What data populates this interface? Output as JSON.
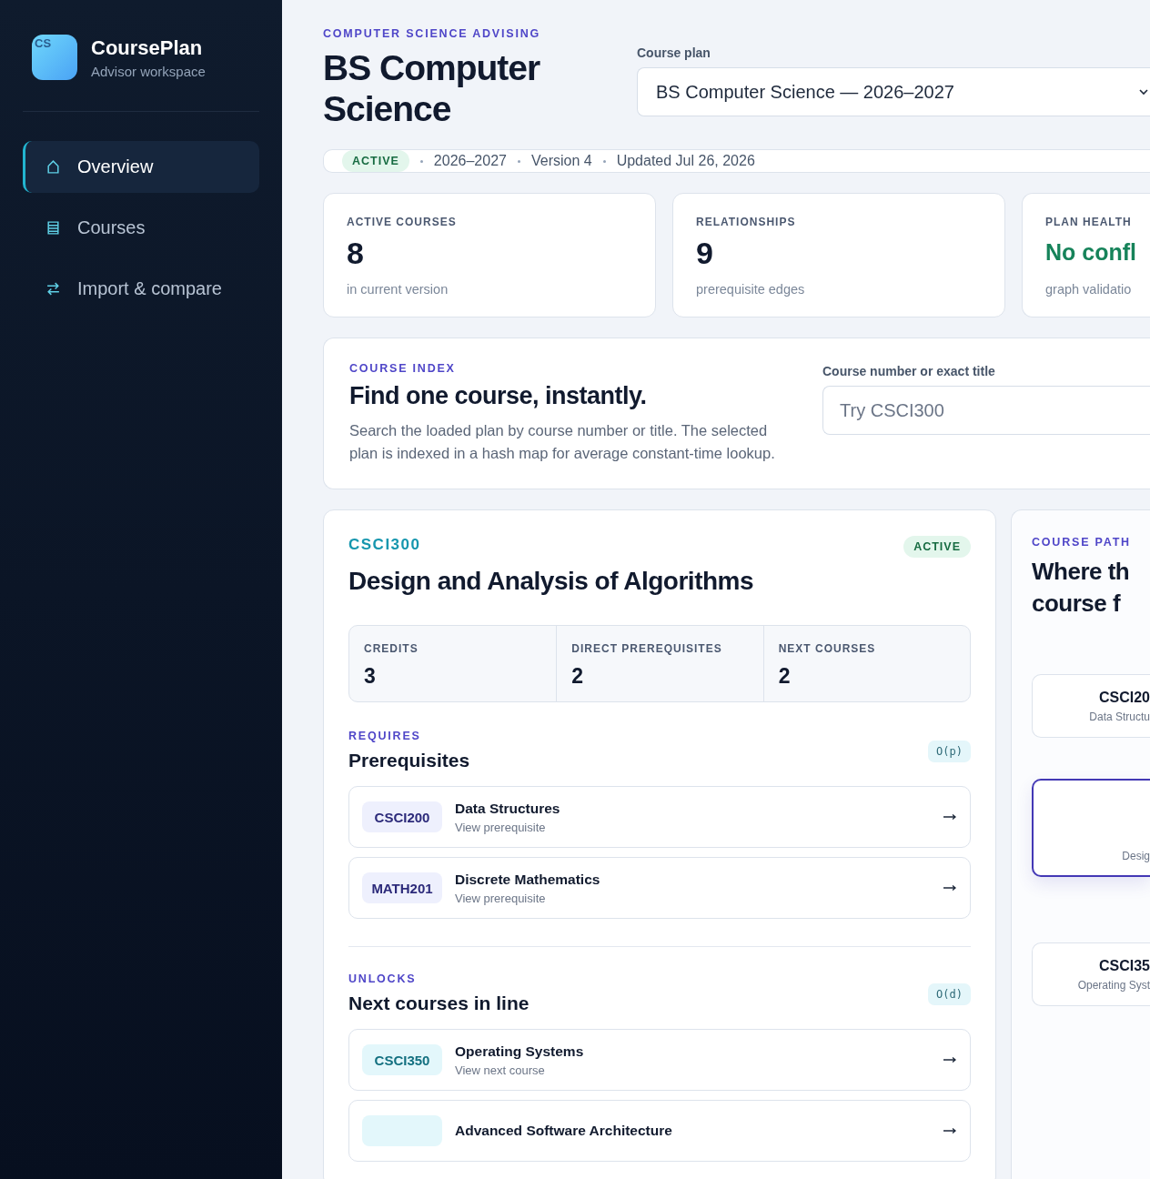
{
  "sidebar": {
    "logo_text": "CS",
    "app_name": "CoursePlan",
    "subtitle": "Advisor workspace",
    "items": [
      {
        "label": "Overview",
        "kind": "home",
        "selected": true
      },
      {
        "label": "Courses",
        "kind": "list",
        "selected": false
      },
      {
        "label": "Import & compare",
        "kind": "swap",
        "selected": false
      }
    ]
  },
  "header": {
    "eyebrow": "COMPUTER SCIENCE ADVISING",
    "title": "BS Computer Science",
    "plan_label": "Course plan",
    "plan_value": "BS Computer Science — 2026–2027"
  },
  "meta": {
    "status": "ACTIVE",
    "items": [
      "2026–2027",
      "Version 4",
      "Updated Jul 26, 2026"
    ]
  },
  "stats": [
    {
      "label": "ACTIVE COURSES",
      "value": "8",
      "note": "in current version",
      "kind": "number"
    },
    {
      "label": "RELATIONSHIPS",
      "value": "9",
      "note": "prerequisite edges",
      "kind": "number"
    },
    {
      "label": "PLAN HEALTH",
      "value": "No confl",
      "note": "graph validatio",
      "kind": "status"
    }
  ],
  "index": {
    "eyebrow": "COURSE INDEX",
    "title": "Find one course, instantly.",
    "description": "Search the loaded plan by course number or title. The selected plan is indexed in a hash map for average constant-time lookup.",
    "field_label": "Course number or exact title",
    "placeholder": "Try CSCI300"
  },
  "course": {
    "code": "CSCI300",
    "title": "Design and Analysis of Algorithms",
    "status": "ACTIVE",
    "metrics": [
      {
        "label": "CREDITS",
        "value": "3"
      },
      {
        "label": "DIRECT PREREQUISITES",
        "value": "2"
      },
      {
        "label": "NEXT COURSES",
        "value": "2"
      }
    ],
    "sections": [
      {
        "kind": "prerequisite",
        "eyebrow": "REQUIRES",
        "title": "Prerequisites",
        "complexity": "O(p)",
        "rows": [
          {
            "code": "CSCI200",
            "title": "Data Structures",
            "action": "View prerequisite"
          },
          {
            "code": "MATH201",
            "title": "Discrete Mathematics",
            "action": "View prerequisite"
          }
        ]
      },
      {
        "kind": "unlock",
        "eyebrow": "UNLOCKS",
        "title": "Next courses in line",
        "complexity": "O(d)",
        "rows": [
          {
            "code": "CSCI350",
            "title": "Operating Systems",
            "action": "View next course"
          },
          {
            "title": "Advanced Software Architecture"
          }
        ]
      }
    ]
  },
  "path": {
    "eyebrow": "COURSE PATH",
    "title_lines": [
      "Where th",
      "course f"
    ],
    "nodes": [
      {
        "code": "CSCI20",
        "name": "Data Structu",
        "selected": false
      },
      {
        "name": "Desig",
        "selected": true
      },
      {
        "code": "CSCI35",
        "name": "Operating Syst",
        "selected": false
      }
    ]
  }
}
